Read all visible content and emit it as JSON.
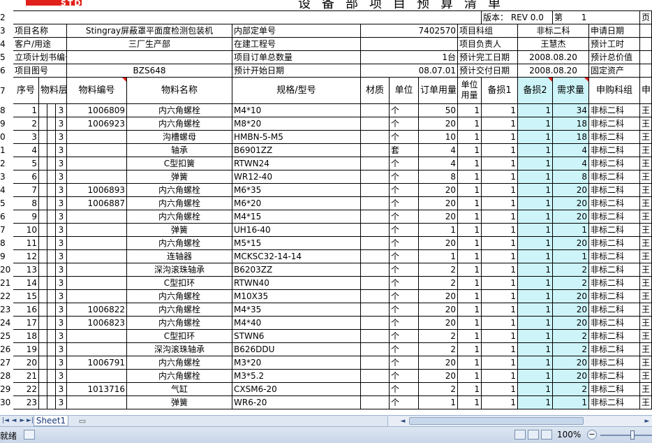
{
  "title": {
    "logo_text": "STD",
    "doc_title": "设备部项目预算清单"
  },
  "row_numbers": [
    "2",
    "3",
    "4",
    "5",
    "6",
    "7",
    "8",
    "9",
    "0",
    "1",
    "2",
    "3",
    "4",
    "5",
    "6",
    "7",
    "8",
    "9",
    "20",
    "21",
    "22",
    "23",
    "24",
    "25",
    "26",
    "27",
    "28",
    "29",
    "30"
  ],
  "version_row": {
    "version_label": "版本：",
    "version_value": "REV 0.0",
    "page_label": "第",
    "page_value": "1",
    "page_suffix": "页"
  },
  "info": {
    "r3": [
      "项目名称",
      "Stingray屏蔽罩平面度检测包装机",
      "内部定单号",
      "7402570",
      "项目科组",
      "非标二科",
      "申请日期"
    ],
    "r4": [
      "客户/用途",
      "三厂生产部",
      "在建工程号",
      "",
      "项目负责人",
      "王慧杰",
      "预计工时"
    ],
    "r5": [
      "立项计划书编号",
      "",
      "项目订单总数量",
      "1台",
      "预计完工日期",
      "2008.08.20",
      "预计总价值"
    ],
    "r6": [
      "项目图号",
      "BZS648",
      "预计开始日期",
      "08.07.01",
      "预计交付日期",
      "2008.08.20",
      "固定资产"
    ]
  },
  "headers": [
    "序号",
    "物料层次",
    "物料编号",
    "物料名称",
    "规格/型号",
    "材质",
    "单位",
    "订单用量",
    "单位用量",
    "备损1",
    "备损2",
    "需求量",
    "申购科组",
    "申"
  ],
  "rows": [
    {
      "no": "1",
      "lvl": "3",
      "code": "1006809",
      "name": "内六角螺栓",
      "spec": "M4*10",
      "unit": "个",
      "order": "50",
      "unitq": "1",
      "loss1": "1",
      "loss2": "1",
      "need": "34",
      "dept": "非标二科",
      "buyer": "王"
    },
    {
      "no": "2",
      "lvl": "3",
      "code": "1006923",
      "name": "内六角螺栓",
      "spec": "M8*20",
      "unit": "个",
      "order": "20",
      "unitq": "1",
      "loss1": "1",
      "loss2": "1",
      "need": "18",
      "dept": "非标二科",
      "buyer": "王"
    },
    {
      "no": "3",
      "lvl": "3",
      "code": "",
      "name": "沟槽螺母",
      "spec": "HMBN-5-M5",
      "unit": "个",
      "order": "10",
      "unitq": "1",
      "loss1": "1",
      "loss2": "1",
      "need": "18",
      "dept": "非标二科",
      "buyer": "王"
    },
    {
      "no": "4",
      "lvl": "3",
      "code": "",
      "name": "轴承",
      "spec": "B6901ZZ",
      "unit": "套",
      "order": "4",
      "unitq": "1",
      "loss1": "1",
      "loss2": "1",
      "need": "4",
      "dept": "非标二科",
      "buyer": "王"
    },
    {
      "no": "5",
      "lvl": "3",
      "code": "",
      "name": "C型扣簧",
      "spec": "RTWN24",
      "unit": "个",
      "order": "4",
      "unitq": "1",
      "loss1": "1",
      "loss2": "1",
      "need": "4",
      "dept": "非标二科",
      "buyer": "王"
    },
    {
      "no": "6",
      "lvl": "3",
      "code": "",
      "name": "弹簧",
      "spec": "WR12-40",
      "unit": "个",
      "order": "8",
      "unitq": "1",
      "loss1": "1",
      "loss2": "1",
      "need": "8",
      "dept": "非标二科",
      "buyer": "王"
    },
    {
      "no": "7",
      "lvl": "3",
      "code": "1006893",
      "name": "内六角螺栓",
      "spec": "M6*35",
      "unit": "个",
      "order": "20",
      "unitq": "1",
      "loss1": "1",
      "loss2": "1",
      "need": "20",
      "dept": "非标二科",
      "buyer": "王"
    },
    {
      "no": "8",
      "lvl": "3",
      "code": "1006887",
      "name": "内六角螺栓",
      "spec": "M6*20",
      "unit": "个",
      "order": "20",
      "unitq": "1",
      "loss1": "1",
      "loss2": "1",
      "need": "20",
      "dept": "非标二科",
      "buyer": "王"
    },
    {
      "no": "9",
      "lvl": "3",
      "code": "",
      "name": "内六角螺栓",
      "spec": "M4*15",
      "unit": "个",
      "order": "20",
      "unitq": "1",
      "loss1": "1",
      "loss2": "1",
      "need": "20",
      "dept": "非标二科",
      "buyer": "王"
    },
    {
      "no": "10",
      "lvl": "3",
      "code": "",
      "name": "弹簧",
      "spec": "UH16-40",
      "unit": "个",
      "order": "1",
      "unitq": "1",
      "loss1": "1",
      "loss2": "1",
      "need": "1",
      "dept": "非标二科",
      "buyer": "王"
    },
    {
      "no": "11",
      "lvl": "3",
      "code": "",
      "name": "内六角螺栓",
      "spec": "M5*15",
      "unit": "个",
      "order": "20",
      "unitq": "1",
      "loss1": "1",
      "loss2": "1",
      "need": "20",
      "dept": "非标二科",
      "buyer": "王"
    },
    {
      "no": "12",
      "lvl": "3",
      "code": "",
      "name": "连轴器",
      "spec": "MCKSC32-14-14",
      "unit": "个",
      "order": "1",
      "unitq": "1",
      "loss1": "1",
      "loss2": "1",
      "need": "1",
      "dept": "非标二科",
      "buyer": "王"
    },
    {
      "no": "13",
      "lvl": "3",
      "code": "",
      "name": "深沟滚珠轴承",
      "spec": "B6203ZZ",
      "unit": "个",
      "order": "2",
      "unitq": "1",
      "loss1": "1",
      "loss2": "1",
      "need": "2",
      "dept": "非标二科",
      "buyer": "王"
    },
    {
      "no": "14",
      "lvl": "3",
      "code": "",
      "name": "C型扣环",
      "spec": "RTWN40",
      "unit": "个",
      "order": "2",
      "unitq": "1",
      "loss1": "1",
      "loss2": "1",
      "need": "2",
      "dept": "非标二科",
      "buyer": "王"
    },
    {
      "no": "15",
      "lvl": "3",
      "code": "",
      "name": "内六角螺栓",
      "spec": "M10X35",
      "unit": "个",
      "order": "20",
      "unitq": "1",
      "loss1": "1",
      "loss2": "1",
      "need": "20",
      "dept": "非标二科",
      "buyer": "王"
    },
    {
      "no": "16",
      "lvl": "3",
      "code": "1006822",
      "name": "内六角螺栓",
      "spec": "M4*35",
      "unit": "个",
      "order": "20",
      "unitq": "1",
      "loss1": "1",
      "loss2": "1",
      "need": "20",
      "dept": "非标二科",
      "buyer": "王"
    },
    {
      "no": "17",
      "lvl": "3",
      "code": "1006823",
      "name": "内六角螺栓",
      "spec": "M4*40",
      "unit": "个",
      "order": "20",
      "unitq": "1",
      "loss1": "1",
      "loss2": "1",
      "need": "20",
      "dept": "非标二科",
      "buyer": "王"
    },
    {
      "no": "18",
      "lvl": "3",
      "code": "",
      "name": "C型扣环",
      "spec": "STWN6",
      "unit": "个",
      "order": "2",
      "unitq": "1",
      "loss1": "1",
      "loss2": "1",
      "need": "2",
      "dept": "非标二科",
      "buyer": "王"
    },
    {
      "no": "19",
      "lvl": "3",
      "code": "",
      "name": "深沟滚珠轴承",
      "spec": "B626DDU",
      "unit": "个",
      "order": "2",
      "unitq": "1",
      "loss1": "1",
      "loss2": "1",
      "need": "2",
      "dept": "非标二科",
      "buyer": "王"
    },
    {
      "no": "20",
      "lvl": "3",
      "code": "1006791",
      "name": "内六角螺栓",
      "spec": "M3*20",
      "unit": "个",
      "order": "20",
      "unitq": "1",
      "loss1": "1",
      "loss2": "1",
      "need": "20",
      "dept": "非标二科",
      "buyer": "王"
    },
    {
      "no": "21",
      "lvl": "3",
      "code": "",
      "name": "内六角螺栓",
      "spec": "M3*5.2",
      "unit": "个",
      "order": "20",
      "unitq": "1",
      "loss1": "1",
      "loss2": "1",
      "need": "20",
      "dept": "非标二科",
      "buyer": "王"
    },
    {
      "no": "22",
      "lvl": "3",
      "code": "1013716",
      "name": "气缸",
      "spec": "CXSM6-20",
      "unit": "个",
      "order": "2",
      "unitq": "1",
      "loss1": "1",
      "loss2": "1",
      "need": "2",
      "dept": "非标二科",
      "buyer": "王"
    },
    {
      "no": "23",
      "lvl": "3",
      "code": "",
      "name": "弹簧",
      "spec": "WR6-20",
      "unit": "个",
      "order": "1",
      "unitq": "1",
      "loss1": "1",
      "loss2": "1",
      "need": "1",
      "dept": "非标二科",
      "buyer": "王"
    }
  ],
  "tabs": {
    "sheet1": "Sheet1"
  },
  "status": {
    "ready": "就绪",
    "zoom": "100%"
  },
  "colors": {
    "accent_blue": "#cdf5f9",
    "logo_red": "#e0201a"
  }
}
